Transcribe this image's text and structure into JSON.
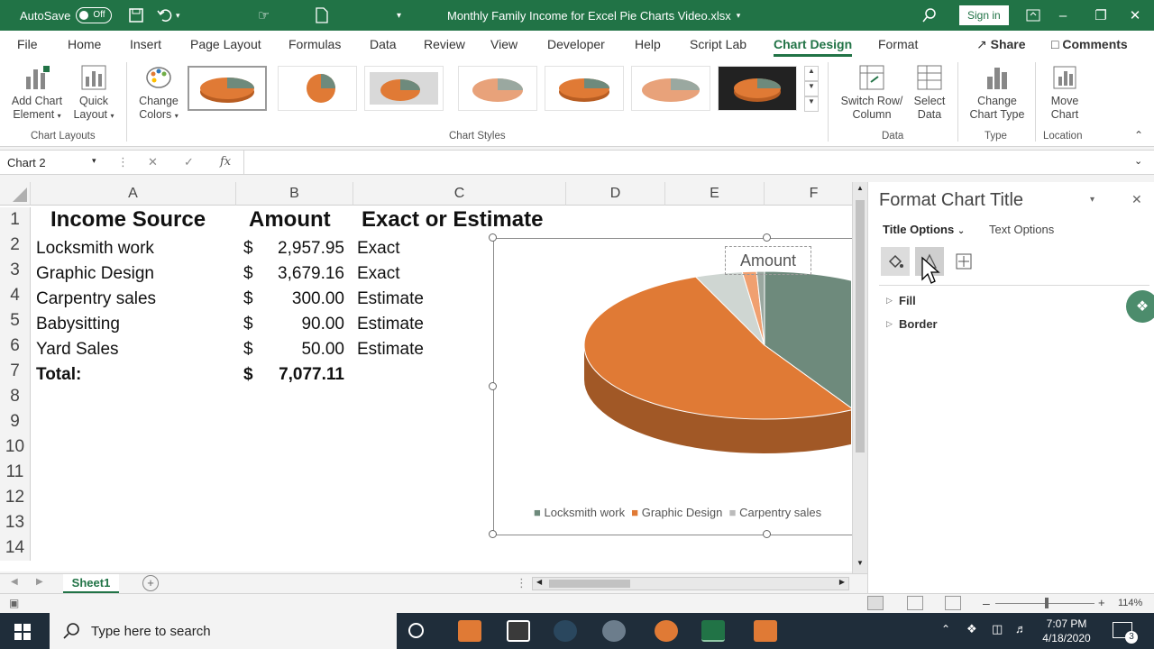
{
  "titlebar": {
    "autosave_label": "AutoSave",
    "autosave_state": "Off",
    "filename": "Monthly Family Income for Excel Pie Charts Video.xlsx",
    "signin_label": "Sign in"
  },
  "menu": {
    "items": [
      "File",
      "Home",
      "Insert",
      "Page Layout",
      "Formulas",
      "Data",
      "Review",
      "View",
      "Developer",
      "Help",
      "Script Lab",
      "Chart Design",
      "Format"
    ],
    "active": "Chart Design",
    "share_label": "Share",
    "comments_label": "Comments"
  },
  "ribbon": {
    "add_chart_element": [
      "Add Chart",
      "Element"
    ],
    "quick_layout": [
      "Quick",
      "Layout"
    ],
    "change_colors": [
      "Change",
      "Colors"
    ],
    "switch_row_col": [
      "Switch Row/",
      "Column"
    ],
    "select_data": [
      "Select",
      "Data"
    ],
    "change_chart_type": [
      "Change",
      "Chart Type"
    ],
    "move_chart": [
      "Move",
      "Chart"
    ],
    "groups": {
      "chart_layouts": "Chart Layouts",
      "chart_styles": "Chart Styles",
      "data": "Data",
      "type": "Type",
      "location": "Location"
    }
  },
  "formula_bar": {
    "name_box": "Chart 2",
    "fx_label": "fx"
  },
  "grid": {
    "columns": [
      "A",
      "B",
      "C",
      "D",
      "E",
      "F"
    ],
    "rows": [
      "1",
      "2",
      "3",
      "4",
      "5",
      "6",
      "7",
      "8",
      "9",
      "10",
      "11",
      "12",
      "13",
      "14"
    ],
    "header": {
      "a": "Income Source",
      "b": "Amount",
      "c": "Exact or Estimate"
    },
    "records": [
      {
        "source": "Locksmith work",
        "currency": "$",
        "amount": "2,957.95",
        "type": "Exact"
      },
      {
        "source": "Graphic Design",
        "currency": "$",
        "amount": "3,679.16",
        "type": "Exact"
      },
      {
        "source": "Carpentry sales",
        "currency": "$",
        "amount": "300.00",
        "type": "Estimate"
      },
      {
        "source": "Babysitting",
        "currency": "$",
        "amount": "90.00",
        "type": "Estimate"
      },
      {
        "source": "Yard Sales",
        "currency": "$",
        "amount": "50.00",
        "type": "Estimate"
      }
    ],
    "total": {
      "label": "Total:",
      "currency": "$",
      "amount": "7,077.11"
    }
  },
  "chart": {
    "title": "Amount",
    "legend": [
      "Locksmith work",
      "Graphic Design",
      "Carpentry sales"
    ],
    "colors": {
      "locksmith": "#6e8a7c",
      "graphic": "#e07a35",
      "carpentry": "#cfd6d2",
      "babysitting": "#f0a070",
      "yard": "#9aa8a0"
    }
  },
  "chart_data": {
    "type": "pie",
    "title": "Amount",
    "categories": [
      "Locksmith work",
      "Graphic Design",
      "Carpentry sales",
      "Babysitting",
      "Yard Sales"
    ],
    "values": [
      2957.95,
      3679.16,
      300.0,
      90.0,
      50.0
    ],
    "legend_position": "bottom",
    "style": "3-D"
  },
  "sheet": {
    "tab": "Sheet1"
  },
  "status": {
    "zoom": "114%"
  },
  "pane": {
    "title": "Format Chart Title",
    "tab_title_options": "Title Options",
    "tab_text_options": "Text Options",
    "fill_label": "Fill",
    "border_label": "Border"
  },
  "taskbar": {
    "search_placeholder": "Type here to search",
    "time": "7:07 PM",
    "date": "4/18/2020",
    "notification_count": "3"
  }
}
